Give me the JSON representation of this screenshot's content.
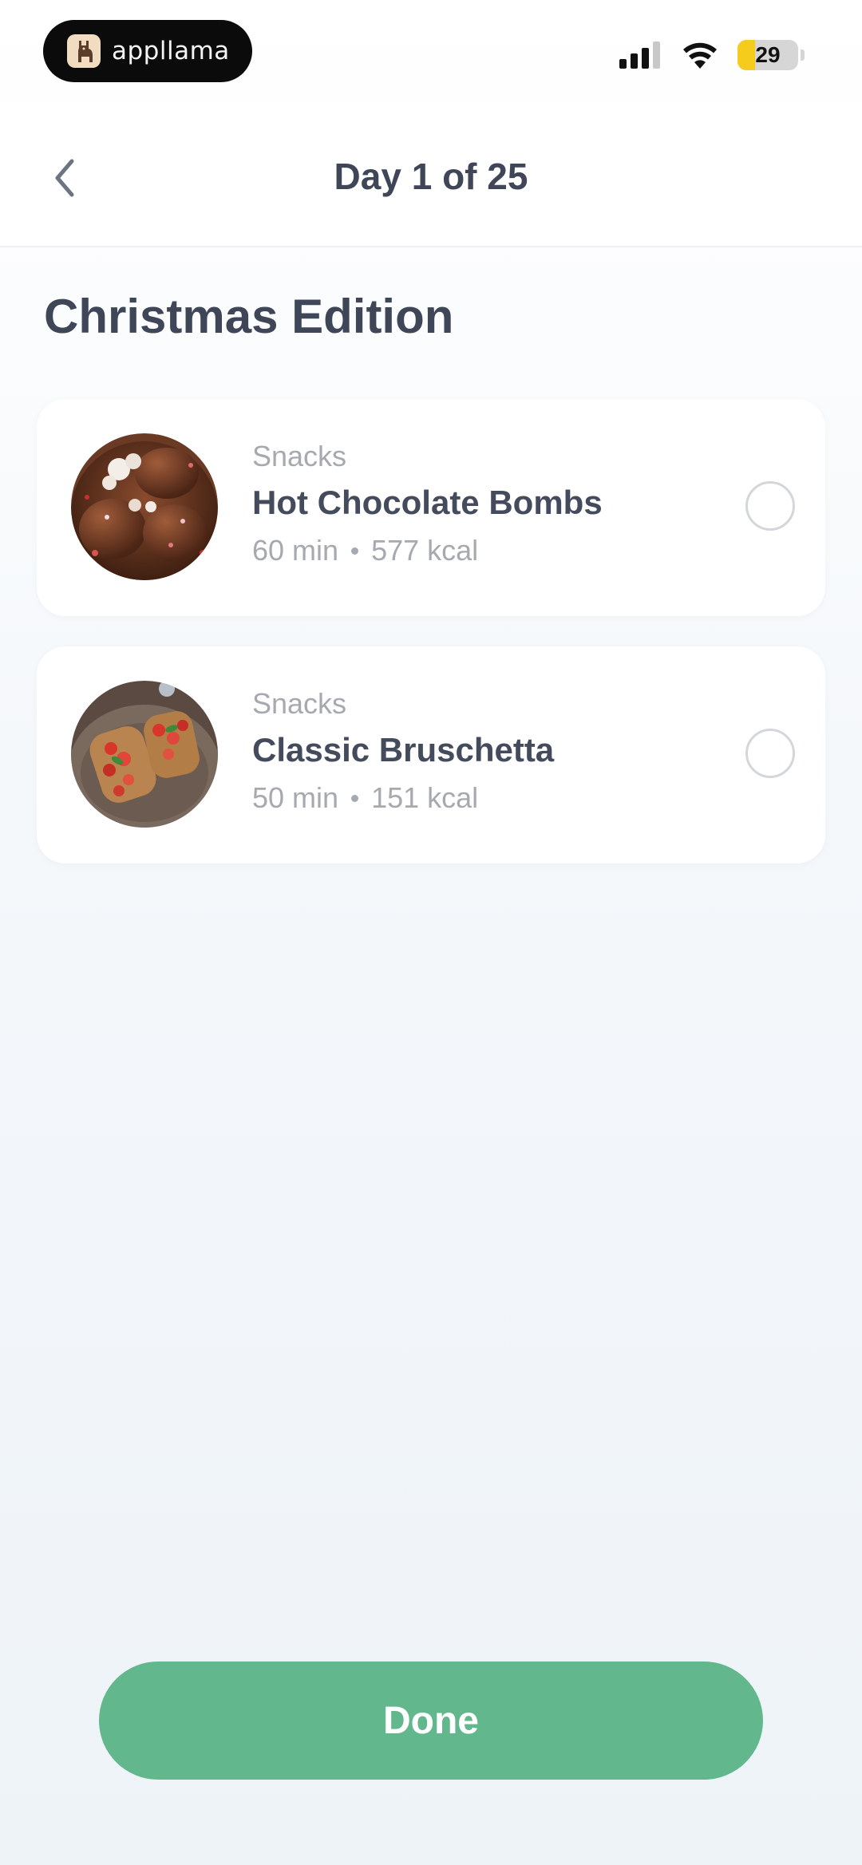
{
  "status_bar": {
    "brand_name": "appllama",
    "battery_level": "29",
    "battery_fraction": 0.29,
    "icons": [
      "llama-logo-icon",
      "cellular-signal-icon",
      "wifi-icon",
      "battery-icon"
    ]
  },
  "nav": {
    "title": "Day 1 of 25",
    "back_icon": "chevron-left-icon"
  },
  "section": {
    "title": "Christmas Edition"
  },
  "recipes": [
    {
      "category": "Snacks",
      "name": "Hot Chocolate Bombs",
      "time": "60 min",
      "calories": "577 kcal",
      "checked": false
    },
    {
      "category": "Snacks",
      "name": "Classic Bruschetta",
      "time": "50 min",
      "calories": "151 kcal",
      "checked": false
    }
  ],
  "footer": {
    "done_label": "Done"
  },
  "colors": {
    "accent": "#62b78c",
    "text": "#3f4657",
    "muted": "#a6a9b0",
    "battery": "#f5cc1c"
  }
}
